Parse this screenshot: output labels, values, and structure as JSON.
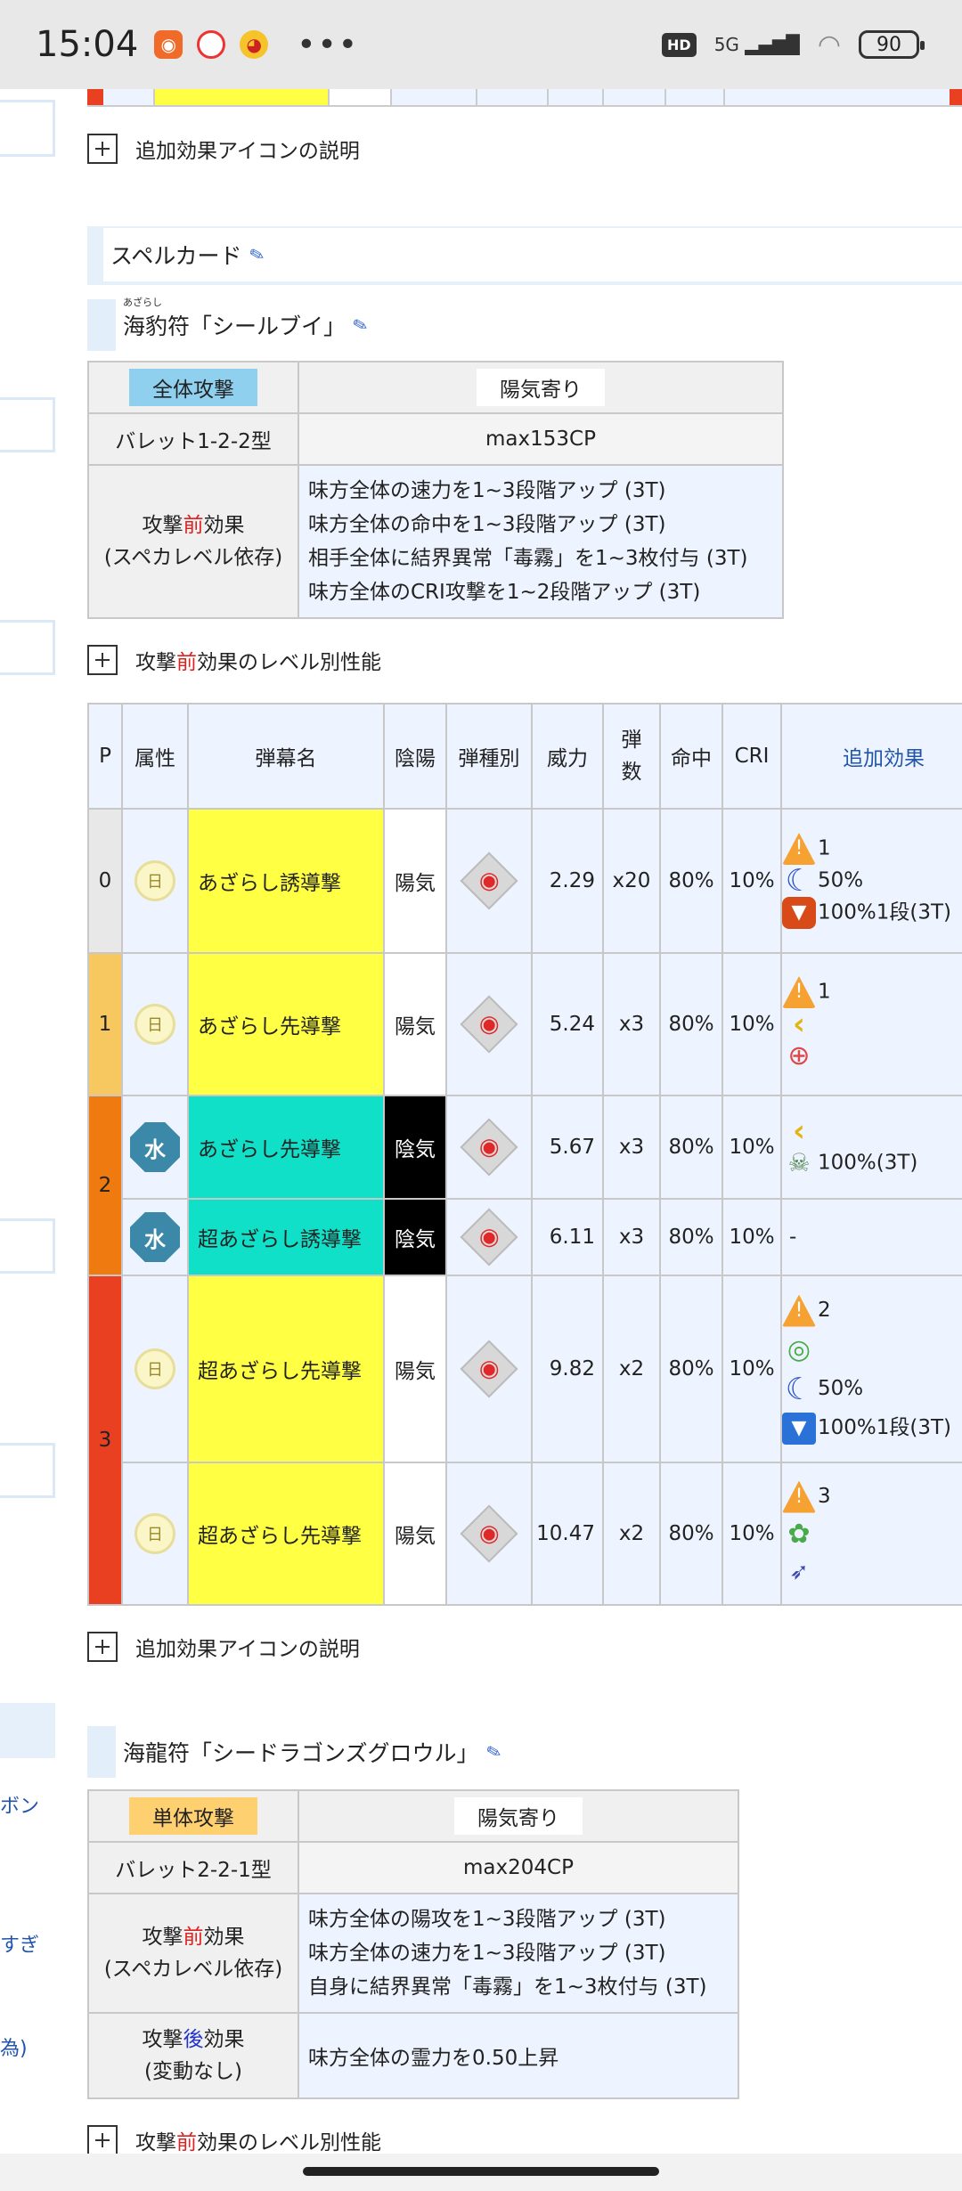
{
  "status": {
    "time": "15:04",
    "hd": "HD",
    "network": "5G",
    "battery": "90",
    "more": "•••"
  },
  "sidebar": {
    "texts": [
      "ボン",
      "すぎ",
      "為)"
    ]
  },
  "links": {
    "icon_explain_1": "追加効果アイコンの説明",
    "icon_explain_2": "追加効果アイコンの説明",
    "level_perf_1_pre": "攻撃",
    "level_perf_1_red": "前",
    "level_perf_1_post": "効果のレベル別性能",
    "level_perf_2_pre": "攻撃",
    "level_perf_2_red": "前",
    "level_perf_2_post": "効果のレベル別性能"
  },
  "section_title": "スペルカード",
  "card1": {
    "ruby": "あざらし",
    "title": "海豹符「シールブイ」",
    "attack_type": "全体攻撃",
    "yinyang": "陽気寄り",
    "barrett": "バレット1-2-2型",
    "max_cp": "max153CP",
    "pre_label_a": "攻撃",
    "pre_label_red": "前",
    "pre_label_b": "効果",
    "pre_label_sub": "(スペカレベル依存)",
    "pre_effects": [
      "味方全体の速力を1~3段階アップ (3T)",
      "味方全体の命中を1~3段階アップ (3T)",
      "相手全体に結界異常「毒霧」を1~3枚付与 (3T)",
      "味方全体のCRI攻撃を1~2段階アップ (3T)"
    ]
  },
  "table": {
    "headers": [
      "P",
      "属性",
      "弾幕名",
      "陰陽",
      "弾種別",
      "威力",
      "弾\n数",
      "命中",
      "CRI",
      "追加効果"
    ],
    "rows": [
      {
        "p": "0",
        "attr": "日",
        "name": "あざらし誘導撃",
        "yy": "陽気",
        "power": "2.29",
        "count": "x20",
        "hit": "80%",
        "cri": "10%",
        "fx": [
          "1",
          "50%",
          "100%1段(3T)"
        ]
      },
      {
        "p": "1",
        "attr": "日",
        "name": "あざらし先導撃",
        "yy": "陽気",
        "power": "5.24",
        "count": "x3",
        "hit": "80%",
        "cri": "10%",
        "fx": [
          "1",
          "",
          ""
        ]
      },
      {
        "p": "2",
        "attr": "水",
        "name": "あざらし先導撃",
        "yy": "陰気",
        "power": "5.67",
        "count": "x3",
        "hit": "80%",
        "cri": "10%",
        "fx": [
          "",
          "100%(3T)"
        ]
      },
      {
        "p": "",
        "attr": "水",
        "name": "超あざらし誘導撃",
        "yy": "陰気",
        "power": "6.11",
        "count": "x3",
        "hit": "80%",
        "cri": "10%",
        "fx": [
          "-"
        ]
      },
      {
        "p": "3",
        "attr": "日",
        "name": "超あざらし先導撃",
        "yy": "陽気",
        "power": "9.82",
        "count": "x2",
        "hit": "80%",
        "cri": "10%",
        "fx": [
          "2",
          "",
          "50%",
          "100%1段(3T)"
        ]
      },
      {
        "p": "",
        "attr": "日",
        "name": "超あざらし先導撃",
        "yy": "陽気",
        "power": "10.47",
        "count": "x2",
        "hit": "80%",
        "cri": "10%",
        "fx": [
          "3",
          "",
          ""
        ]
      }
    ]
  },
  "card2": {
    "title": "海龍符「シードラゴンズグロウル」",
    "attack_type": "単体攻撃",
    "yinyang": "陽気寄り",
    "barrett": "バレット2-2-1型",
    "max_cp": "max204CP",
    "pre_label_a": "攻撃",
    "pre_label_red": "前",
    "pre_label_b": "効果",
    "pre_label_sub": "(スペカレベル依存)",
    "pre_effects": [
      "味方全体の陽攻を1~3段階アップ (3T)",
      "味方全体の速力を1~3段階アップ (3T)",
      "自身に結界異常「毒霧」を1~3枚付与 (3T)"
    ],
    "post_label_a": "攻撃",
    "post_label_blue": "後",
    "post_label_b": "効果",
    "post_label_sub": "(変動なし)",
    "post_effect": "味方全体の霊力を0.50上昇"
  },
  "colors": {
    "yellow_cell": "#ffff44",
    "cyan_cell": "#10e0c8",
    "p0": "#e8e8e8",
    "p1": "#f8c860",
    "p2": "#ee7a10",
    "p3": "#e84020",
    "link_blue": "#2255aa"
  }
}
